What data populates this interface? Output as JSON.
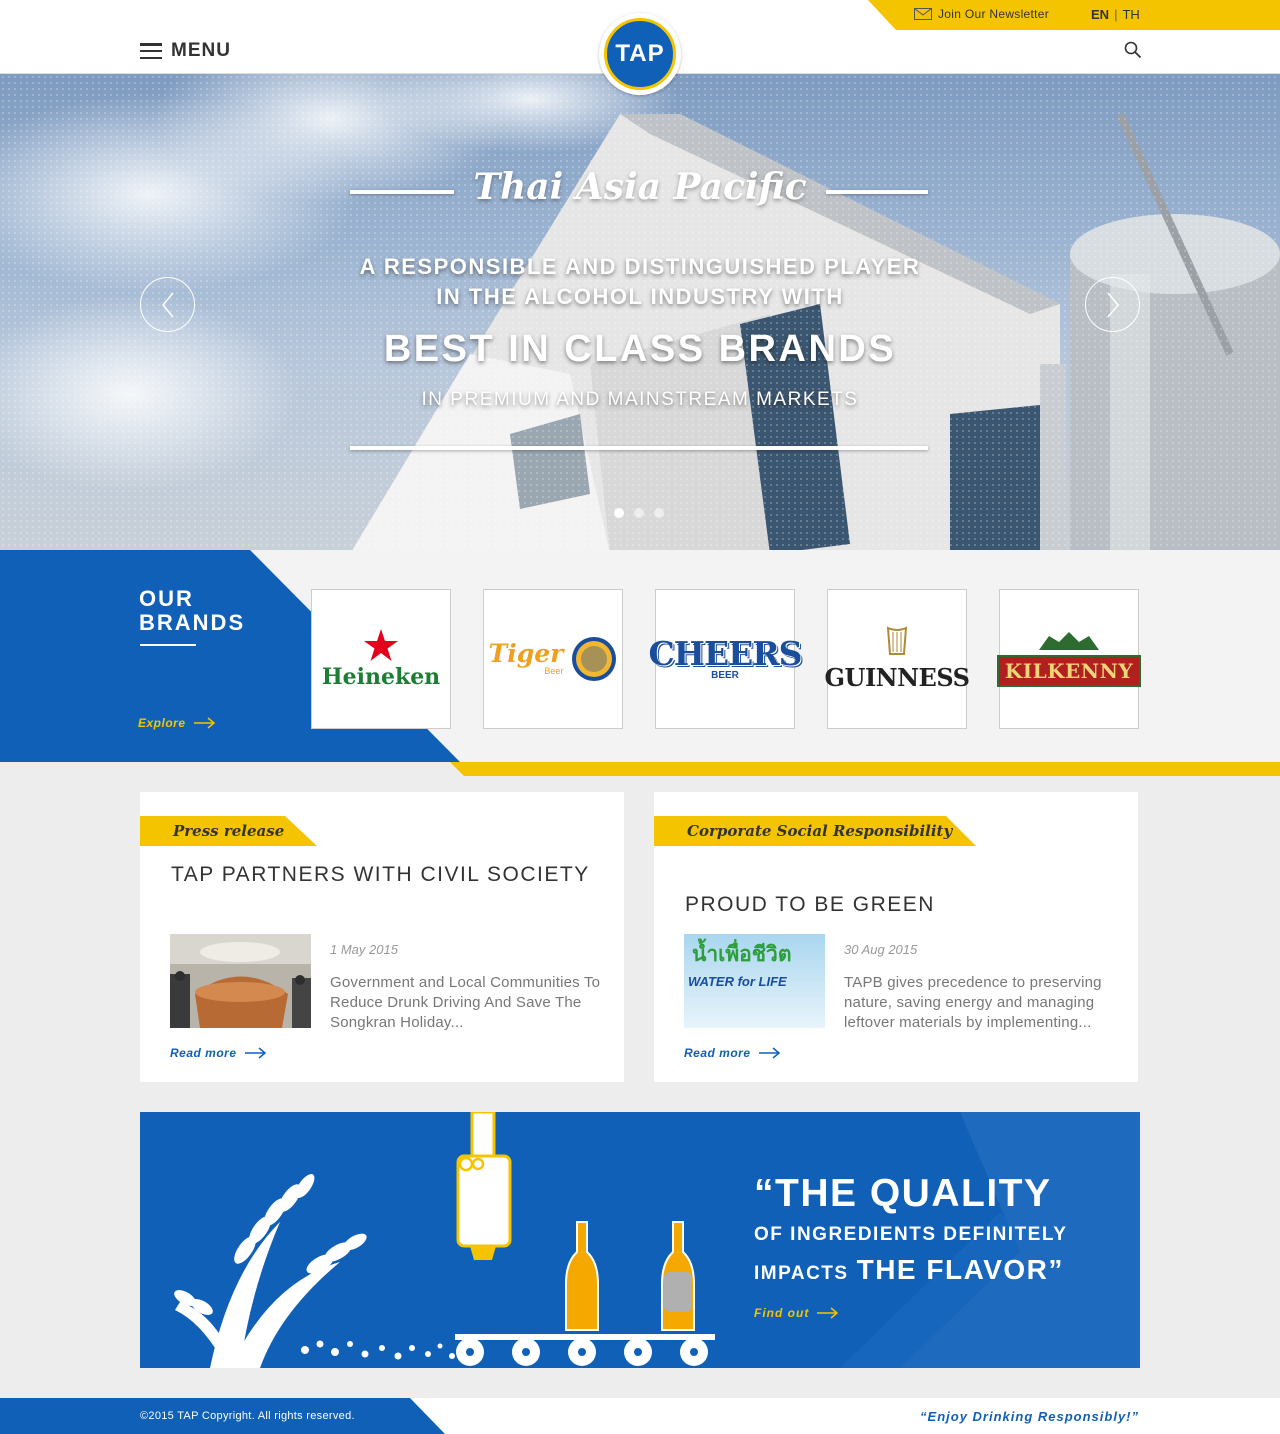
{
  "header": {
    "menu_label": "MENU",
    "logo_text": "TAP",
    "newsletter_label": "Join Our Newsletter",
    "lang_en": "EN",
    "lang_sep": "|",
    "lang_th": "TH"
  },
  "hero": {
    "title": "Thai Asia Pacific",
    "line1": "A RESPONSIBLE AND DISTINGUISHED PLAYER",
    "line2": "IN THE ALCOHOL INDUSTRY WITH",
    "headline": "BEST IN CLASS BRANDS",
    "line3": "IN PREMIUM AND MAINSTREAM MARKETS",
    "slide_count": 3,
    "active_slide": 1
  },
  "brands": {
    "title_line1": "OUR",
    "title_line2": "BRANDS",
    "explore_label": "Explore",
    "items": [
      {
        "name": "Heineken"
      },
      {
        "name": "Tiger",
        "sub": "Beer"
      },
      {
        "name": "CHEERS",
        "sub": "BEER"
      },
      {
        "name": "GUINNESS"
      },
      {
        "name": "KILKENNY"
      }
    ]
  },
  "news": [
    {
      "tag": "Press release",
      "title": "TAP PARTNERS WITH CIVIL SOCIETY",
      "date": "1 May 2015",
      "description": "Government and Local Communities To Reduce Drunk Driving And Save The Songkran Holiday...",
      "read_more": "Read more"
    },
    {
      "tag": "Corporate Social Responsibility",
      "title": "PROUD TO BE GREEN",
      "date": "30 Aug 2015",
      "description": "TAPB gives precedence to preserving nature, saving energy and managing leftover materials by implementing...",
      "read_more": "Read more",
      "thumb_text_th": "น้ำเพื่อชีวิต",
      "thumb_text_en": "WATER for LIFE"
    }
  ],
  "banner": {
    "quote_l1": "“THE QUALITY",
    "quote_l2": "OF INGREDIENTS DEFINITELY",
    "quote_l3a": "IMPACTS",
    "quote_l3b": "THE FLAVOR”",
    "find_out": "Find out"
  },
  "footer": {
    "copyright": "©2015 TAP Copyright. All rights reserved.",
    "slogan": "“Enjoy Drinking Responsibly!”"
  },
  "colors": {
    "brand_blue": "#1060b8",
    "brand_yellow": "#f5c400",
    "background": "#ededed"
  }
}
